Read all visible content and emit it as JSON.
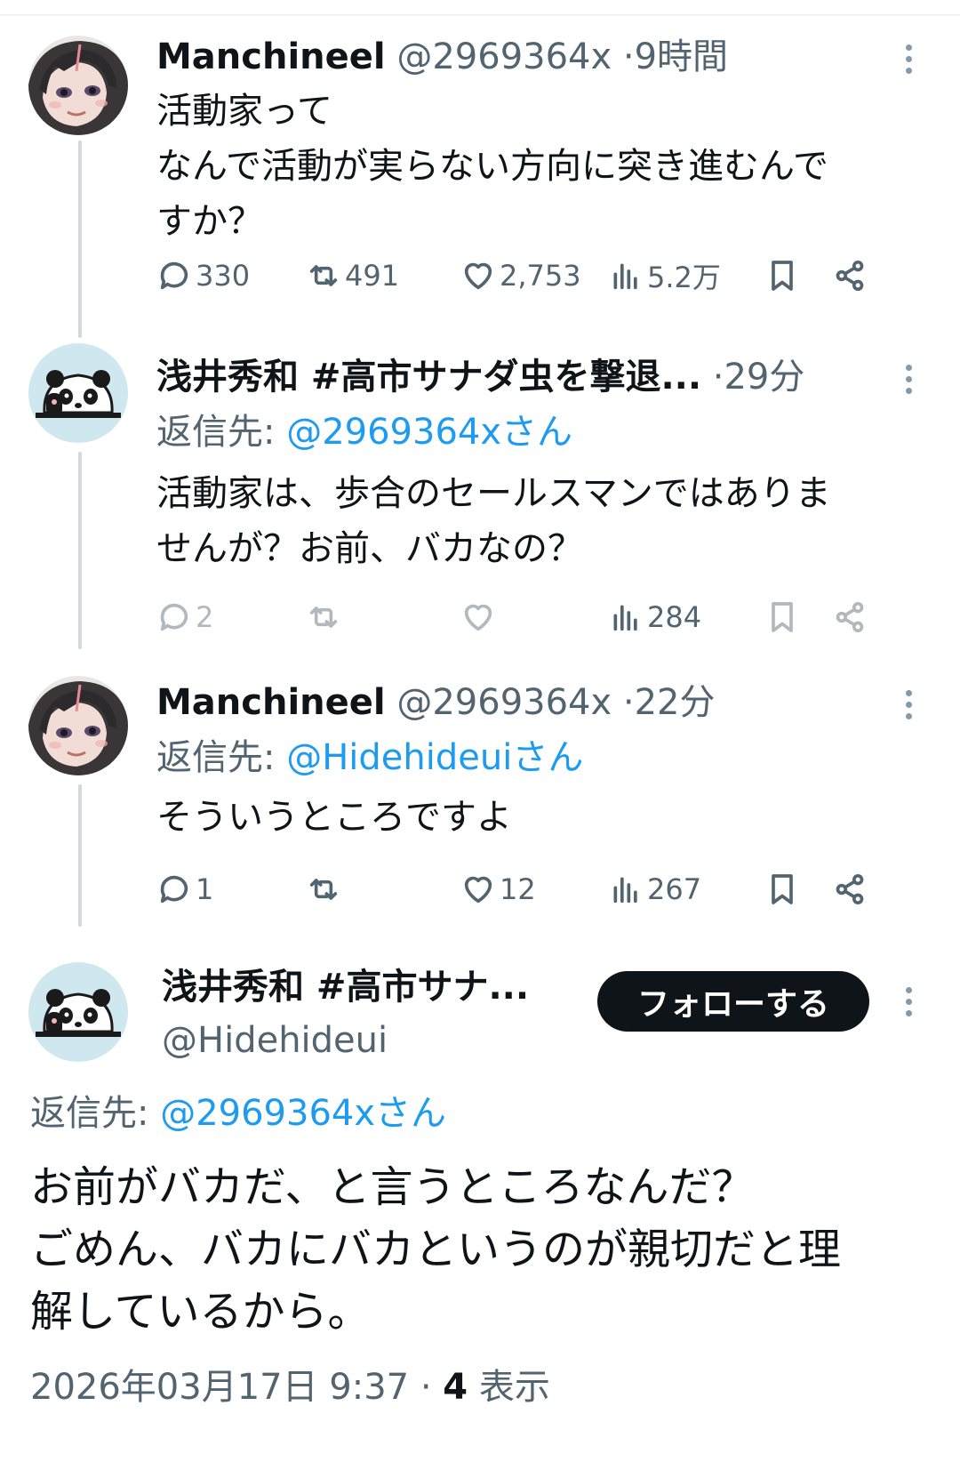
{
  "tweets": [
    {
      "name": "Manchineel",
      "handle": "@2969364x",
      "time": "9時間",
      "replying_label": "",
      "replying_to": "",
      "text": "活動家って\nなんで活動が実らない方向に突き進むんで\nすか？",
      "replies": "330",
      "reposts": "491",
      "likes": "2,753",
      "views": "5.2万"
    },
    {
      "name": "浅井秀和 #高市サナダ虫を撃退...",
      "handle": "",
      "time": "29分",
      "replying_label": "返信先:",
      "replying_to": "@2969364xさん",
      "text": "活動家は、歩合のセールスマンではありま\nせんが？お前、バカなの？",
      "replies": "2",
      "reposts": "",
      "likes": "",
      "views": "284"
    },
    {
      "name": "Manchineel",
      "handle": "@2969364x",
      "time": "22分",
      "replying_label": "返信先:",
      "replying_to": "@Hidehideuiさん",
      "text": "そういうところですよ",
      "replies": "1",
      "reposts": "",
      "likes": "12",
      "views": "267"
    }
  ],
  "main": {
    "name": "浅井秀和 #高市サナ...",
    "handle": "@Hidehideui",
    "follow_label": "フォローする",
    "replying_label": "返信先:",
    "replying_to": "@2969364xさん",
    "text": "お前がバカだ、と言うところなんだ？\nごめん、バカにバカというのが親切だと理\n解しているから。",
    "timestamp": "2026年03月17日 9:37",
    "views_count": "4",
    "views_label": "表示"
  },
  "icons": [
    "reply-icon",
    "repost-icon",
    "like-icon",
    "views-icon",
    "bookmark-icon",
    "share-icon",
    "more-icon"
  ],
  "colors": {
    "link": "#1d9bf0",
    "muted": "#536471",
    "text": "#0f1419",
    "thread_line": "#cfd9de",
    "follow_bg": "#0f1419"
  }
}
